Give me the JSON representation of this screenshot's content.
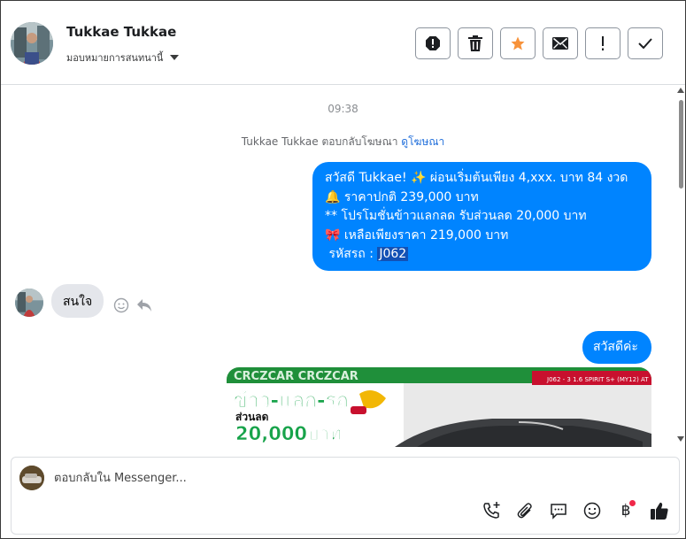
{
  "header": {
    "contact_name": "Tukkae Tukkae",
    "assign_label": "มอบหมายการสนทนานี้",
    "actions": [
      {
        "name": "report-icon"
      },
      {
        "name": "trash-icon"
      },
      {
        "name": "star-icon"
      },
      {
        "name": "mail-icon"
      },
      {
        "name": "exclamation-icon"
      },
      {
        "name": "check-icon"
      }
    ]
  },
  "conversation": {
    "timestamp": "09:38",
    "ad_reply_text": "Tukkae Tukkae ตอบกลับโฆษณา",
    "ad_link_text": "ดูโฆษณา",
    "outgoing_1": {
      "line1": "สวัสดี Tukkae! ✨  ผ่อนเริ่มต้นเพียง 4,xxx. บาท 84 งวด",
      "line2": "🔔 ราคาปกติ 239,000 บาท",
      "line3": "** โปรโมชั่นข้าวแลกลด รับส่วนลด 20,000 บาท",
      "line4": "🎀  เหลือเพียงราคา 219,000 บาท",
      "line5_label": " รหัสรถ : ",
      "line5_code": "J062"
    },
    "incoming_1": "สนใจ",
    "outgoing_2": "สวัสดีค่ะ",
    "image": {
      "banner_top": "CRCZCAR CRCZCAR",
      "promo_title": "ข้าว-แลก-รถ",
      "promo_discount_label": "ส่วนลด",
      "promo_amount": "20,000บาท",
      "car_code": "J062 - 3 1.6 SPIRIT S+ (MY12) AT",
      "colors": {
        "green": "#17a34a",
        "red": "#c8102e",
        "gold": "#f2b705"
      }
    }
  },
  "composer": {
    "placeholder": "ตอบกลับใน Messenger...",
    "tools": [
      "phone-plus-icon",
      "paperclip-icon",
      "chat-bubble-icon",
      "smiley-icon",
      "baht-icon",
      "thumbs-up-icon"
    ],
    "baht_symbol": "฿"
  },
  "colors": {
    "outgoing_bubble": "#0084ff",
    "incoming_bubble": "#e4e6eb",
    "link": "#216fdb"
  }
}
